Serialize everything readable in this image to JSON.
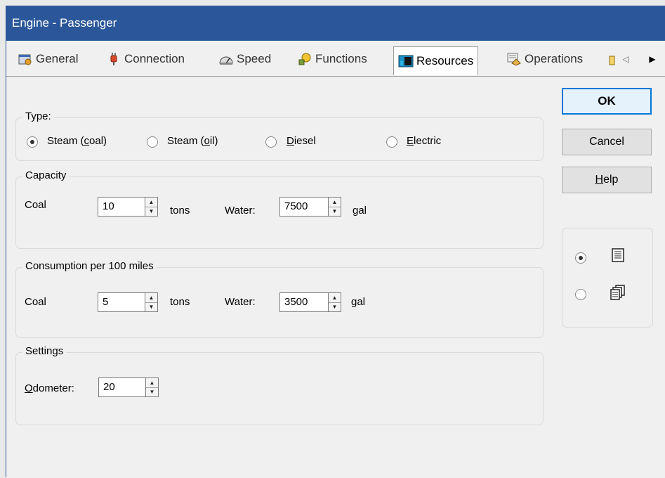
{
  "window": {
    "title": "Engine - Passenger"
  },
  "tabs": [
    {
      "label": "General"
    },
    {
      "label": "Connection"
    },
    {
      "label": "Speed"
    },
    {
      "label": "Functions"
    },
    {
      "label": "Resources"
    },
    {
      "label": "Operations"
    }
  ],
  "type_group": {
    "legend": "Type:",
    "options": [
      "Steam (coal)",
      "Steam (oil)",
      "Diesel",
      "Electric"
    ],
    "selected": "Steam (coal)"
  },
  "capacity": {
    "legend": "Capacity",
    "coal_label": "Coal",
    "coal_value": "10",
    "coal_unit": "tons",
    "water_label": "Water:",
    "water_value": "7500",
    "water_unit": "gal"
  },
  "consumption": {
    "legend": "Consumption per 100 miles",
    "coal_label": "Coal",
    "coal_value": "5",
    "coal_unit": "tons",
    "water_label": "Water:",
    "water_value": "3500",
    "water_unit": "gal"
  },
  "settings": {
    "legend": "Settings",
    "odometer_label": "Odometer:",
    "odometer_value": "20"
  },
  "buttons": {
    "ok": "OK",
    "cancel": "Cancel",
    "help": "Help"
  },
  "view_mode": {
    "selected": "single"
  }
}
